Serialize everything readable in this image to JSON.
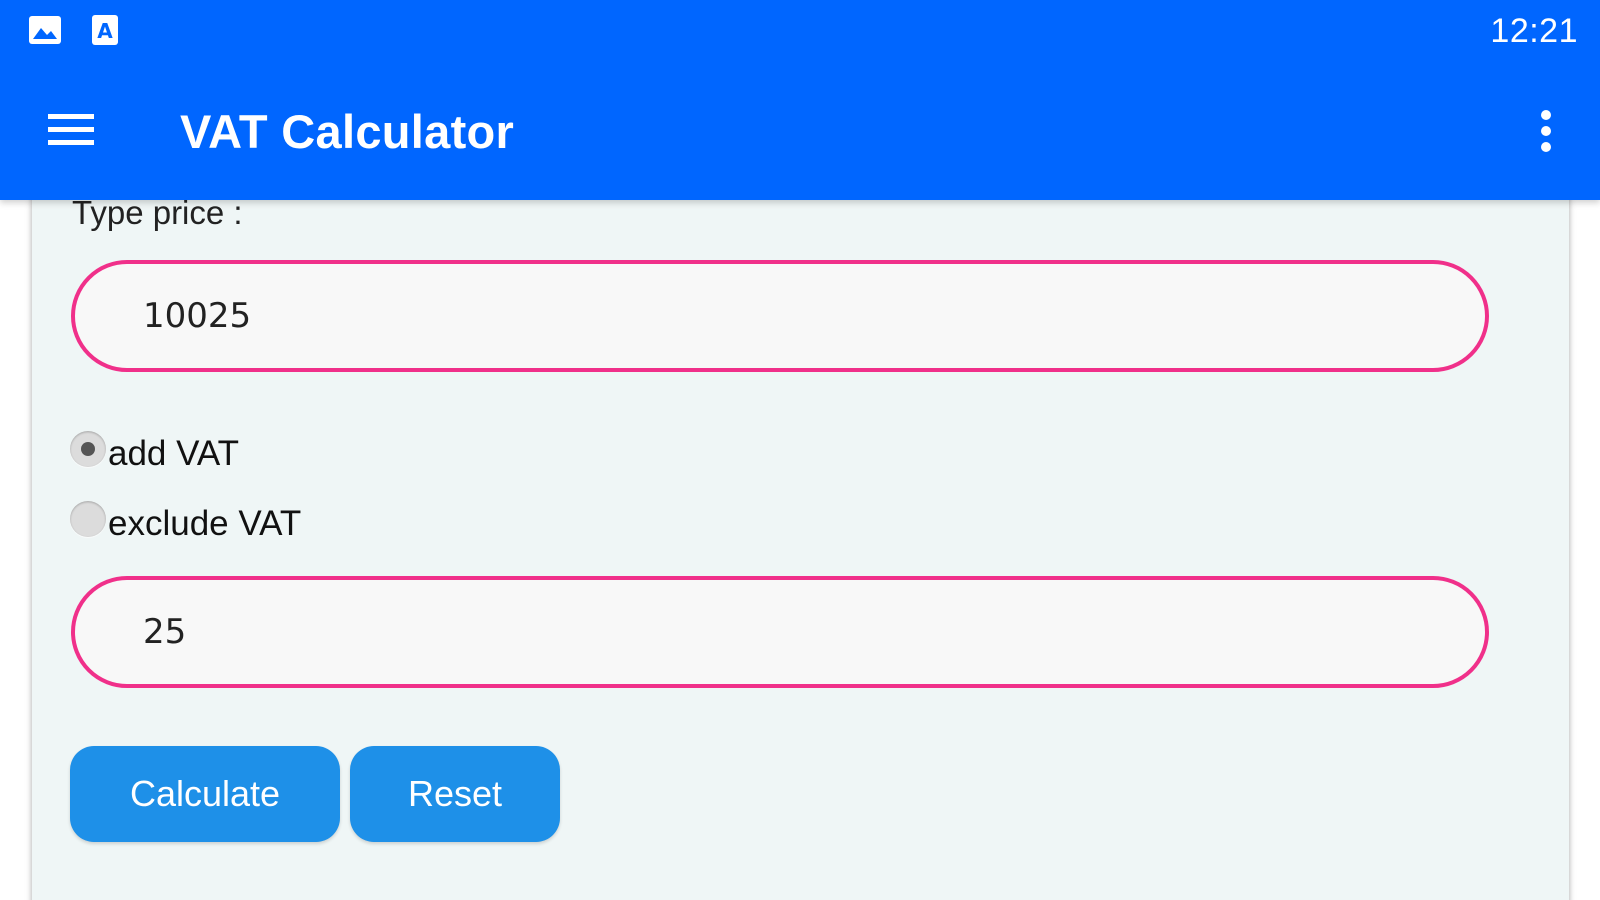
{
  "status_bar": {
    "time": "12:21",
    "icons": [
      "image-notification-icon",
      "text-notification-icon"
    ]
  },
  "app_bar": {
    "title": "VAT Calculator",
    "menu_icon": "hamburger-menu-icon",
    "overflow_icon": "more-vert-icon"
  },
  "form": {
    "price_label": "Type price :",
    "price_value": "10025",
    "mode_options": [
      {
        "label": "add VAT",
        "checked": true
      },
      {
        "label": "exclude VAT",
        "checked": false
      }
    ],
    "rate_value": "25",
    "calculate_label": "Calculate",
    "reset_label": "Reset"
  },
  "colors": {
    "app_bar": "#0066ff",
    "field_border": "#f0308a",
    "button": "#1e90e8",
    "card_background": "#eff6f6"
  }
}
